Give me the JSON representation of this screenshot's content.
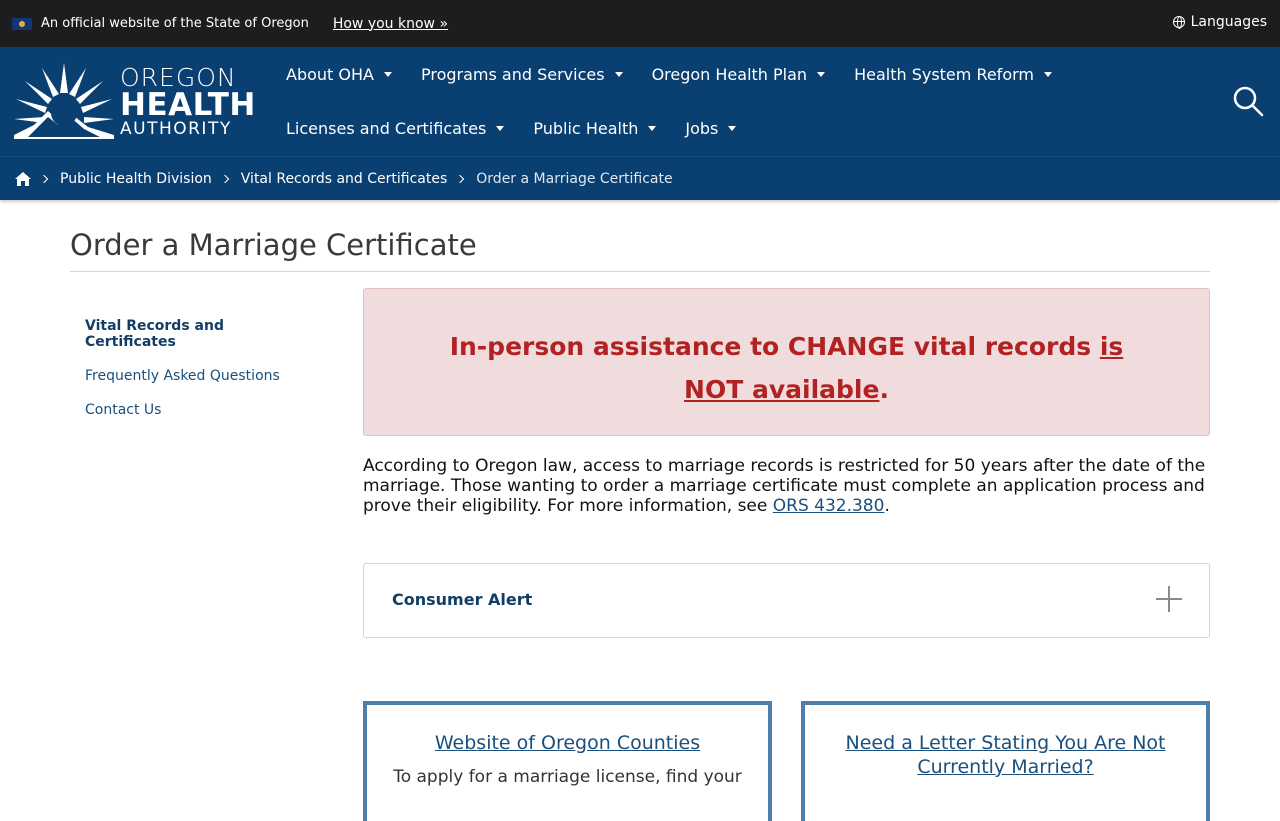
{
  "gov_bar": {
    "official_text": "An official website of the State of Oregon",
    "how_you_know": "How you know »",
    "languages": "Languages"
  },
  "logo": {
    "line1": "OREGON",
    "line2": "HEALTH",
    "line3": "AUTHORITY"
  },
  "nav": {
    "row1": [
      "About OHA",
      "Programs and Services",
      "Oregon Health Plan",
      "Health System Reform"
    ],
    "row2": [
      "Licenses and Certificates",
      "Public Health",
      "Jobs"
    ]
  },
  "breadcrumb": {
    "items": [
      "Public Health Division",
      "Vital Records and Certificates"
    ],
    "current": "Order a Marriage Certificate"
  },
  "page": {
    "title": "Order a Marriage Certificate"
  },
  "sidenav": {
    "items": [
      "Vital Records and Certificates",
      "Frequently Asked Questions",
      "Contact Us"
    ]
  },
  "alert": {
    "text_main": "In-person assistance to CHANGE vital records ",
    "text_emph": "is NOT available",
    "text_end": "."
  },
  "body": {
    "para_text": "According to Oregon law, access to marriage records is restricted for 50 years after the date of the marriage. Those wanting to order a marriage certificate must complete an application process and prove their eligibility. For more information, see ",
    "para_link": "ORS 432.380",
    "para_end": "."
  },
  "accordion": {
    "label": "Consumer Alert"
  },
  "cards": {
    "left_link": "Website of Oregon Counties",
    "left_text": "To apply for a marriage license, find your",
    "right_link": "Need a Letter Stating You Are Not Currently Married?"
  },
  "colors": {
    "header_blue": "#0a3f72",
    "alert_red": "#b22222",
    "link_blue": "#1b4f7c"
  }
}
